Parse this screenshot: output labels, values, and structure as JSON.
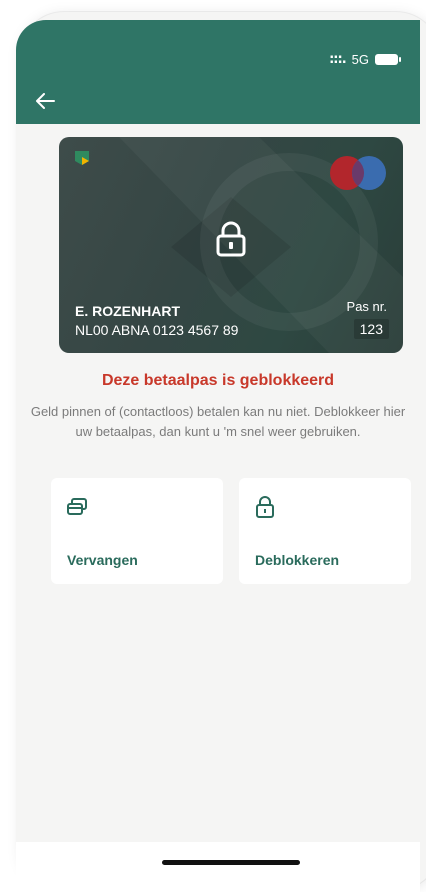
{
  "status_bar": {
    "signal": ":::.",
    "network": "5G"
  },
  "card": {
    "holder_name": "E. ROZENHART",
    "iban": "NL00 ABNA 0123 4567 89",
    "pas_label": "Pas nr.",
    "pas_number": "123"
  },
  "alert": {
    "title": "Deze betaalpas is geblokkeerd",
    "message": "Geld pinnen of (contactloos) betalen kan nu niet. Deblokkeer hier uw betaalpas, dan kunt u 'm snel weer gebruiken."
  },
  "actions": [
    {
      "label": "Vervangen",
      "icon": "cards-icon"
    },
    {
      "label": "Deblokkeren",
      "icon": "lock-icon"
    }
  ],
  "colors": {
    "header": "#2f7566",
    "alert_red": "#c8382a",
    "action_text": "#2a6b5c"
  }
}
